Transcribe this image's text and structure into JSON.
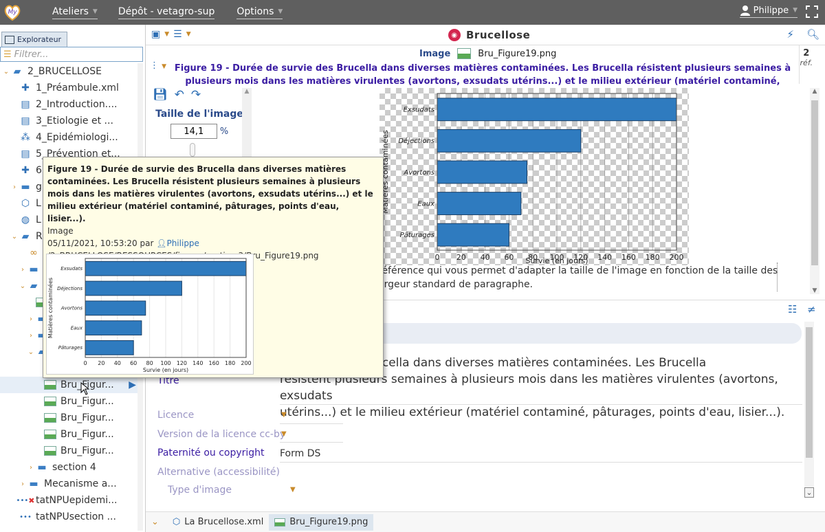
{
  "topbar": {
    "menus": [
      {
        "label": "Ateliers",
        "has_caret": true
      },
      {
        "label": "Dépôt - vetagro-sup",
        "has_caret": false
      },
      {
        "label": "Options",
        "has_caret": true
      }
    ],
    "user": "Philippe",
    "colors": {
      "bar": "#5f5f5f",
      "accent": "#2e6fb5"
    }
  },
  "explorer": {
    "tab_label": "Explorateur",
    "filter_placeholder": "Filtrer...",
    "tree": [
      {
        "label": "2_BRUCELLOSE",
        "indent": 0,
        "icon": "folder-open-icon",
        "exp": "open"
      },
      {
        "label": "1_Préambule.xml",
        "indent": 1,
        "icon": "puzzle-icon",
        "exp": ""
      },
      {
        "label": "2_Introduction....",
        "indent": 1,
        "icon": "briefcase-icon",
        "exp": ""
      },
      {
        "label": "3_Etiologie et ...",
        "indent": 1,
        "icon": "briefcase-icon",
        "exp": ""
      },
      {
        "label": "4_Epidémiologi...",
        "indent": 1,
        "icon": "network-icon",
        "exp": ""
      },
      {
        "label": "5_Prévention et...",
        "indent": 1,
        "icon": "briefcase-icon",
        "exp": ""
      },
      {
        "label": "6",
        "indent": 1,
        "icon": "puzzle-icon",
        "exp": ""
      },
      {
        "label": "g",
        "indent": 1,
        "icon": "folder-icon",
        "exp": "closed"
      },
      {
        "label": "L",
        "indent": 1,
        "icon": "cube-icon",
        "exp": ""
      },
      {
        "label": "L",
        "indent": 1,
        "icon": "globe-icon",
        "exp": ""
      },
      {
        "label": "R",
        "indent": 1,
        "icon": "folder-open-icon",
        "exp": "open"
      },
      {
        "label": "",
        "indent": 2,
        "icon": "link-icon",
        "exp": ""
      },
      {
        "label": "",
        "indent": 2,
        "icon": "folder-icon",
        "exp": "closed"
      },
      {
        "label": "",
        "indent": 2,
        "icon": "folder-open-icon",
        "exp": "open"
      },
      {
        "label": "",
        "indent": 3,
        "icon": "image-icon",
        "exp": ""
      },
      {
        "label": "",
        "indent": 3,
        "icon": "folder-icon",
        "exp": "closed"
      },
      {
        "label": "",
        "indent": 3,
        "icon": "folder-icon",
        "exp": "closed"
      },
      {
        "label": "",
        "indent": 3,
        "icon": "folder-open-icon",
        "exp": "open"
      },
      {
        "label": "",
        "indent": 4,
        "icon": "",
        "exp": ""
      },
      {
        "label": "Bru_Figur...",
        "indent": 4,
        "icon": "image-icon",
        "exp": "",
        "selected": true
      },
      {
        "label": "Bru_Figur...",
        "indent": 4,
        "icon": "image-icon",
        "exp": ""
      },
      {
        "label": "Bru_Figur...",
        "indent": 4,
        "icon": "image-icon",
        "exp": ""
      },
      {
        "label": "Bru_Figur...",
        "indent": 4,
        "icon": "image-icon",
        "exp": ""
      },
      {
        "label": "Bru_Figur...",
        "indent": 4,
        "icon": "image-icon",
        "exp": ""
      },
      {
        "label": "section 4",
        "indent": 3,
        "icon": "folder-icon",
        "exp": "closed"
      },
      {
        "label": "Mecanisme a...",
        "indent": 2,
        "icon": "folder-icon",
        "exp": "closed"
      },
      {
        "label": "tatNPUepidemi...",
        "indent": 1,
        "icon": "error-dots-icon",
        "exp": ""
      },
      {
        "label": "tatNPUsection ...",
        "indent": 1,
        "icon": "dots-icon",
        "exp": ""
      }
    ]
  },
  "editor": {
    "doc_title": "Brucellose",
    "image_label": "Image",
    "image_file": "Bru_Figure19.png",
    "ref_count": "2",
    "ref_label": "réf.",
    "caption": "Figure 19 - Durée de survie des Brucella dans diverses matières contaminées. Les Brucella résistent plusieurs semaines à plusieurs mois dans les matières virulentes (avortons, exsudats utérins...) et le milieu extérieur (matériel contaminé, pâturages, points d'eau, lisier...).",
    "size_label": "Taille de l'image",
    "size_value": "14,1",
    "size_unit": "%",
    "help_text_1": "référence qui vous permet d'adapter la taille de l'image en fonction de la taille des",
    "help_text_2": "argeur standard de paragraphe."
  },
  "properties": {
    "title_label": "Titre",
    "title_value_1": "de survie des Brucella dans diverses matières contaminées. Les Brucella",
    "title_value_2": "résistent plusieurs semaines à plusieurs mois dans les matières virulentes (avortons, exsudats",
    "title_value_3": "utérins...) et le milieu extérieur (matériel contaminé, pâturages, points d'eau, lisier...).",
    "licence_label": "Licence",
    "licence_version_label": "Version de la licence cc-by",
    "copyright_label": "Paternité ou copyright",
    "copyright_value": "Form DS",
    "alt_label": "Alternative (accessibilité)",
    "image_type_label": "Type d'image"
  },
  "bottom_tabs": [
    {
      "label": "La Brucellose.xml",
      "active": false
    },
    {
      "label": "Bru_Figure19.png",
      "active": true
    }
  ],
  "tooltip": {
    "title": "Figure 19 - Durée de survie des Brucella dans diverses matières contaminées. Les Brucella résistent plusieurs semaines à plusieurs mois dans les matières virulentes (avortons, exsudats utérins...) et le milieu extérieur (matériel contaminé, pâturages, points d'eau, lisier...).",
    "type": "Image",
    "date": "05/11/2021, 10:53:20 par",
    "user": "Philippe",
    "path": "/2_BRUCELLOSE/RESSOURCES/figures/section 3/Bru_Figure19.png"
  },
  "chart_data": [
    {
      "type": "bar",
      "orientation": "horizontal",
      "categories": [
        "Exsudats",
        "Déjections",
        "Avortons",
        "Eaux",
        "Pâturages"
      ],
      "values": [
        200,
        120,
        75,
        70,
        60
      ],
      "xlabel": "Survie (en jours)",
      "ylabel": "Matières contaminées",
      "xlim": [
        0,
        200
      ],
      "xticks": [
        0,
        20,
        40,
        60,
        80,
        100,
        120,
        140,
        160,
        180,
        200
      ],
      "grid": true,
      "bar_color": "#2f7bbf"
    }
  ]
}
